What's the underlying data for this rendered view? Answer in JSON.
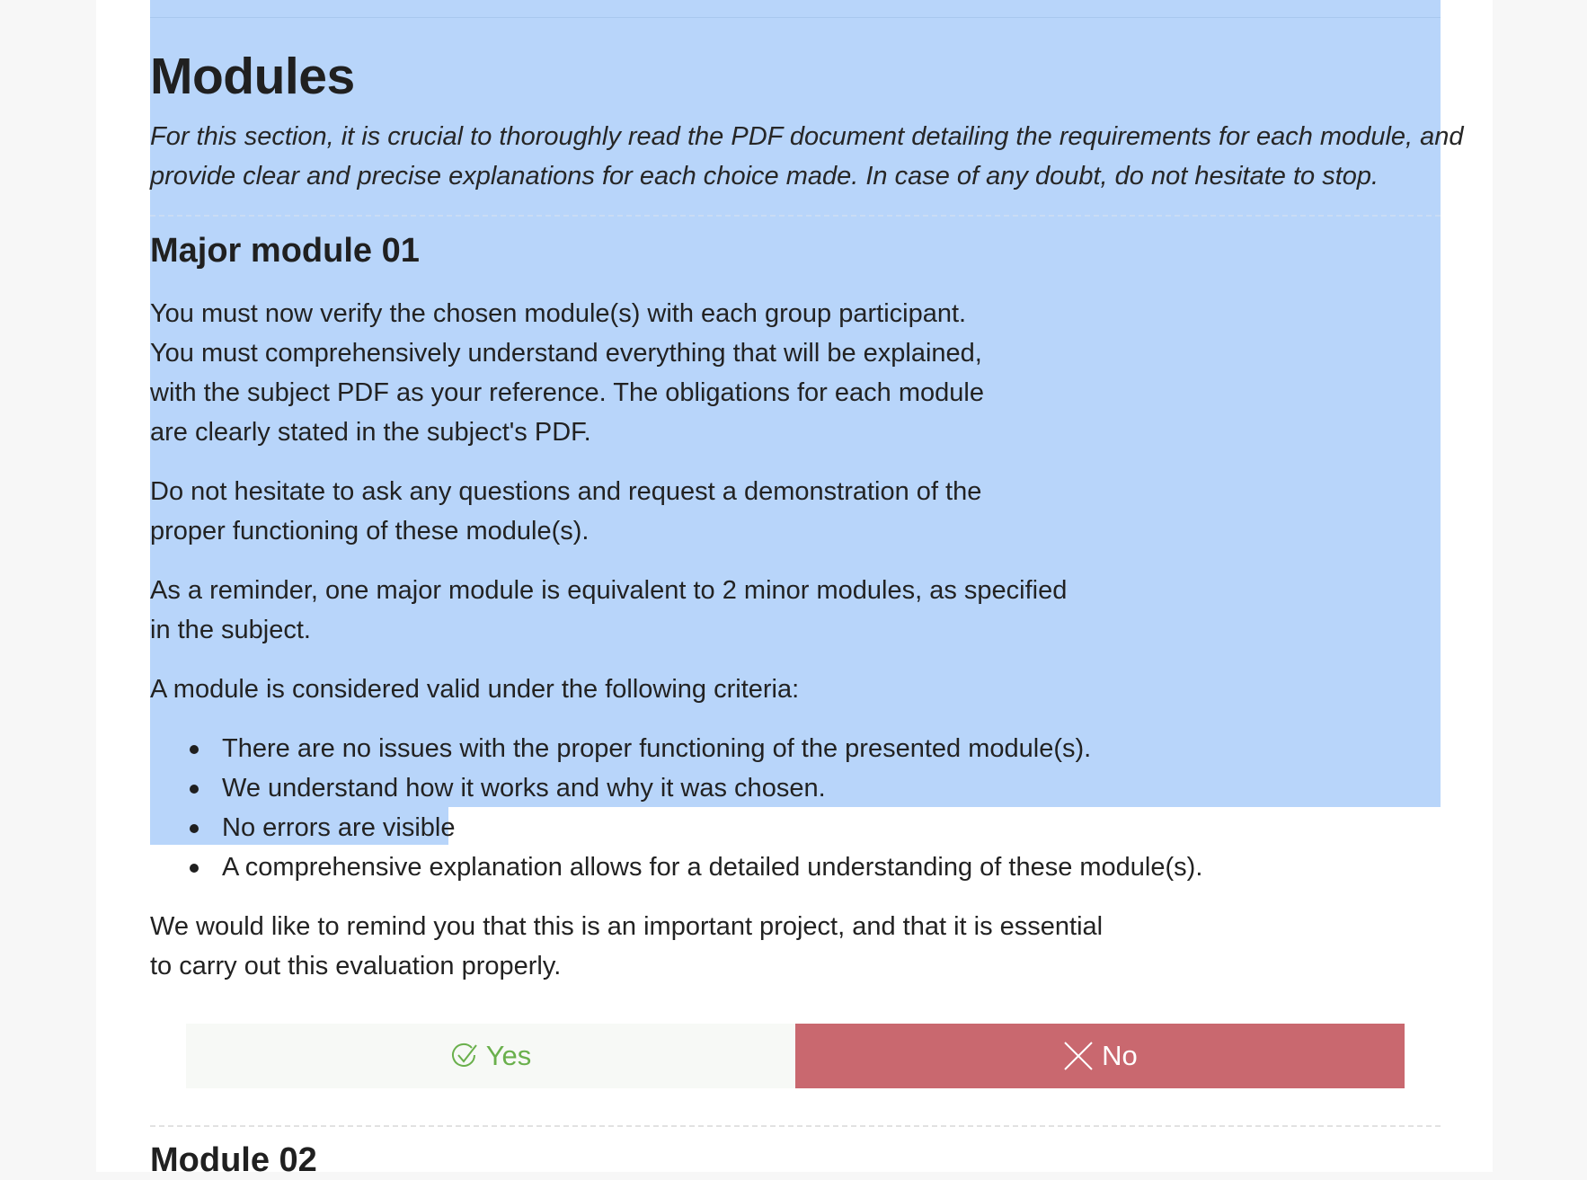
{
  "section": {
    "title": "Modules",
    "intro_lines": [
      "For this section, it is crucial to thoroughly read the PDF document detailing the requirements for each module, and",
      "provide clear and precise explanations for each choice made. In case of any doubt, do not hesitate to stop."
    ]
  },
  "major_module": {
    "title": "Major module 01",
    "paragraphs": [
      [
        "You must now verify the chosen module(s) with each group participant.",
        "You must comprehensively understand everything that will be explained,",
        "with the subject PDF as your reference. The obligations for each module",
        "are clearly stated in the subject's PDF."
      ],
      [
        "Do not hesitate to ask any questions and request a demonstration of the",
        "proper functioning of these module(s)."
      ],
      [
        "As a reminder, one major module is equivalent to 2 minor modules, as specified",
        "in the subject."
      ],
      [
        "A module is considered valid under the following criteria:"
      ]
    ],
    "criteria": [
      "There are no issues with the proper functioning of the presented module(s).",
      "We understand how it works and why it was chosen.",
      "No errors are visible",
      "A comprehensive explanation allows for a detailed understanding of these module(s)."
    ],
    "closing": [
      "We would like to remind you that this is an important project, and that it is essential",
      "to carry out this evaluation properly."
    ]
  },
  "vote": {
    "yes_label": "Yes",
    "no_label": "No",
    "yes_color": "#6ab04c",
    "no_color": "#c9686f",
    "yes_icon": "check-circle-icon",
    "no_icon": "x-icon"
  },
  "next_section": {
    "title": "Module 02"
  },
  "selection_color": "#b8d5fa"
}
